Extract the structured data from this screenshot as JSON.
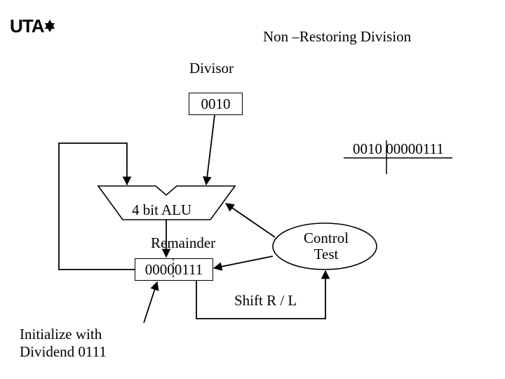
{
  "logo": "UTA",
  "title": "Non –Restoring Division",
  "labels": {
    "divisor": "Divisor",
    "alu": "4 bit ALU",
    "remainder": "Remainder",
    "control_test": "Control\nTest",
    "shift": "Shift R / L",
    "init": "Initialize with\nDividend 0111"
  },
  "values": {
    "divisor_reg": "0010",
    "side_divisor": "0010",
    "side_remainder": "00000111",
    "remainder_reg": "00000111"
  }
}
